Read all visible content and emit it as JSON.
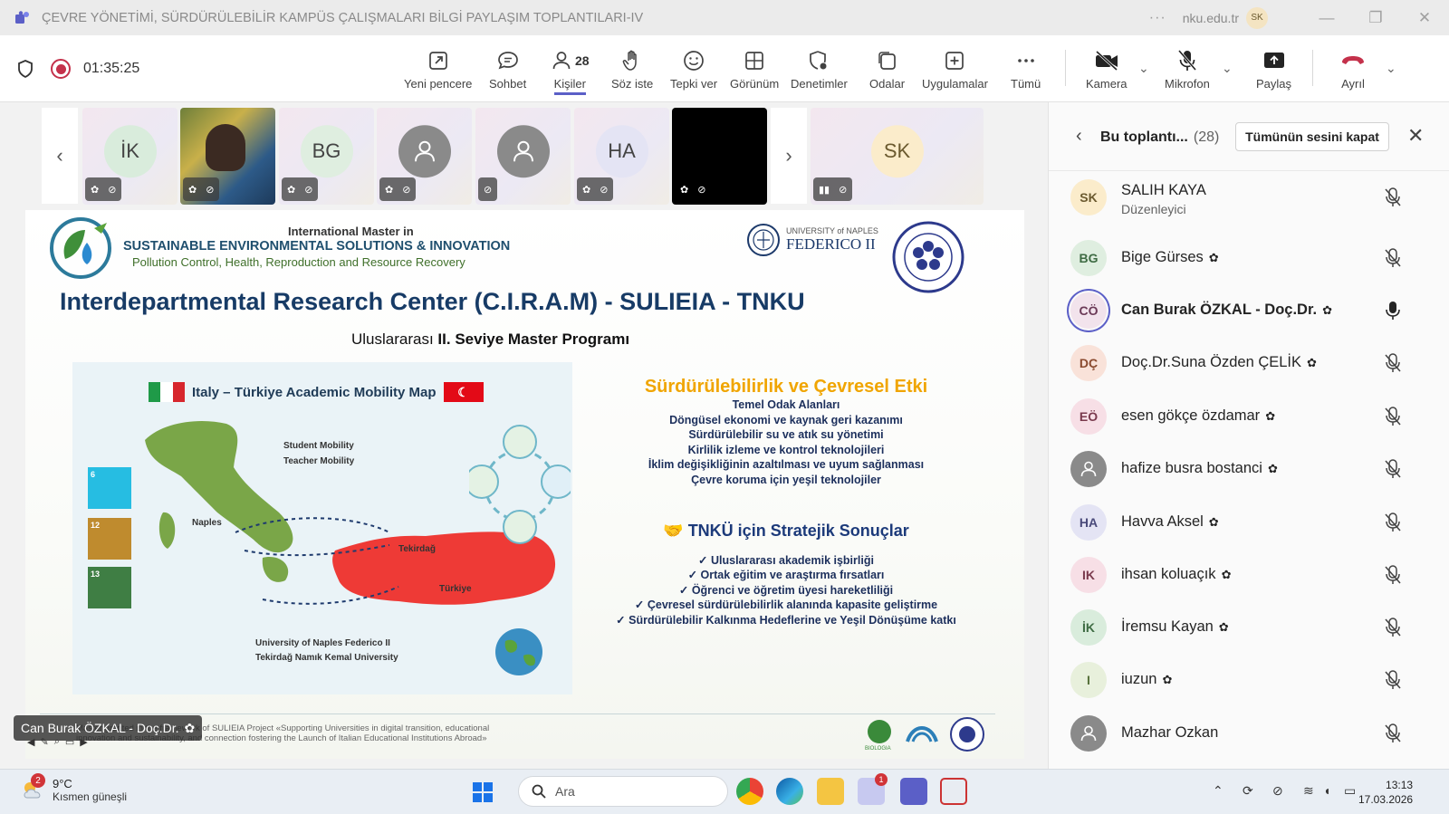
{
  "window": {
    "title": "ÇEVRE YÖNETİMİ, SÜRDÜRÜLEBİLİR KAMPÜS ÇALIŞMALARI BİLGİ PAYLAŞIM TOPLANTILARI-IV",
    "more": "···",
    "org": "nku.edu.tr",
    "avatar": "SK"
  },
  "toolbar": {
    "timer": "01:35:25",
    "people_count": "28",
    "buttons": {
      "new_window": "Yeni pencere",
      "chat": "Sohbet",
      "people": "Kişiler",
      "raise": "Söz iste",
      "react": "Tepki ver",
      "view": "Görünüm",
      "moderation": "Denetimler",
      "rooms": "Odalar",
      "apps": "Uygulamalar",
      "more": "Tümü",
      "camera": "Kamera",
      "mic": "Mikrofon",
      "share": "Paylaş",
      "leave": "Ayrıl"
    },
    "leave_color": "#c4314b",
    "accent": "#5b5fc7"
  },
  "strip": {
    "tiles": [
      {
        "initials": "İK",
        "color": "#d9ecdc"
      },
      {
        "initials": "",
        "color": "#4a5a3a"
      },
      {
        "initials": "BG",
        "color": "#dfeee0"
      },
      {
        "initials": "",
        "color": "#8a8a8a"
      },
      {
        "initials": "",
        "color": "#8a8a8a"
      },
      {
        "initials": "HA",
        "color": "#e4e4f4"
      },
      {
        "initials": "",
        "color": "#000000"
      },
      {
        "initials": "SK",
        "color": "#fbeccb"
      }
    ]
  },
  "slide": {
    "head1": "International Master in",
    "head2": "SUSTAINABLE ENVIRONMENTAL SOLUTIONS & INNOVATION",
    "head3": "Pollution Control, Health, Reproduction and Resource Recovery",
    "unina_small": "UNIVERSITY of NAPLES",
    "unina_big": "FEDERICO II",
    "title": "Interdepartmental Research  Center (C.I.R.A.M) -  SULIEIA   -   TNKU",
    "subtitle_a": "Uluslararası ",
    "subtitle_b": "II. Seviye Master Programı",
    "map": {
      "title": "Italy – Türkiye Academic Mobility Map",
      "student": "Student Mobility",
      "teacher": "Teacher Mobility",
      "naples": "Naples",
      "tekirdag": "Tekirdağ",
      "turkiye": "Türkiye",
      "uni1": "University of Naples Federico II",
      "uni2": "Tekirdağ Namık Kemal University",
      "sdg6": "6",
      "sdg12": "12",
      "sdg13": "13"
    },
    "impact": {
      "heading": "Sürdürülebilirlik ve Çevresel Etki",
      "lines": [
        "Temel Odak Alanları",
        "Döngüsel ekonomi ve kaynak geri kazanımı",
        "Sürdürülebilir su ve atık su yönetimi",
        "Kirlilik izleme ve kontrol teknolojileri",
        "İklim değişikliğinin azaltılması ve uyum sağlanması",
        "Çevre koruma için yeşil teknolojiler"
      ]
    },
    "strategic": {
      "heading": "TNKÜ için Stratejik Sonuçlar",
      "lines": [
        "✓ Uluslararası akademik işbirliği",
        "✓ Ortak eğitim ve araştırma fırsatları",
        "✓ Öğrenci ve öğretim üyesi hareketliliği",
        "✓ Çevresel sürdürülebilirlik alanında kapasite geliştirme",
        "✓ Sürdürülebilir Kalkınma Hedeflerine ve Yeşil Dönüşüme katkı"
      ]
    },
    "footer": "Master granted in the framework of SULIEIA Project «Supporting Universities in digital transition, educational\ninnovation and sustainability, and connection fostering the Launch of Italian Educational Institutions Abroad»",
    "footer_logo": "BIOLOGIA"
  },
  "presenter_chip": "Can Burak ÖZKAL - Doç.Dr.",
  "panel": {
    "title": "Bu toplantı...",
    "count": "(28)",
    "mute_all": "Tümünün sesini kapat",
    "participants": [
      {
        "initials": "SK",
        "name": "SALIH KAYA",
        "role": "Düzenleyici",
        "bg": "#fbeccb",
        "fg": "#6b5a2f",
        "badge": false,
        "mic": "off"
      },
      {
        "initials": "BG",
        "name": "Bige Gürses",
        "role": "",
        "bg": "#dfeee0",
        "fg": "#3e6b43",
        "badge": true,
        "mic": "off"
      },
      {
        "initials": "CÖ",
        "name": "Can Burak ÖZKAL - Doç.Dr.",
        "role": "",
        "bg": "#f2e3ec",
        "fg": "#6b3a57",
        "badge": true,
        "mic": "on"
      },
      {
        "initials": "DÇ",
        "name": "Doç.Dr.Suna Özden ÇELİK",
        "role": "",
        "bg": "#f9e2d9",
        "fg": "#8a4a2f",
        "badge": true,
        "mic": "off"
      },
      {
        "initials": "EÖ",
        "name": "esen gökçe özdamar",
        "role": "",
        "bg": "#f7dfe6",
        "fg": "#7a3a4d",
        "badge": true,
        "mic": "off"
      },
      {
        "initials": "",
        "name": "hafize busra bostanci",
        "role": "",
        "bg": "#8a8a8a",
        "fg": "#ffffff",
        "badge": true,
        "mic": "off"
      },
      {
        "initials": "HA",
        "name": "Havva Aksel",
        "role": "",
        "bg": "#e4e4f4",
        "fg": "#4a4a7a",
        "badge": true,
        "mic": "off"
      },
      {
        "initials": "IK",
        "name": "ihsan koluaçık",
        "role": "",
        "bg": "#f7dfe6",
        "fg": "#7a3a4d",
        "badge": true,
        "mic": "off"
      },
      {
        "initials": "İK",
        "name": "İremsu Kayan",
        "role": "",
        "bg": "#d9ecdc",
        "fg": "#3e6b43",
        "badge": true,
        "mic": "off"
      },
      {
        "initials": "I",
        "name": "iuzun",
        "role": "",
        "bg": "#e8f0dc",
        "fg": "#56703a",
        "badge": true,
        "mic": "off"
      },
      {
        "initials": "",
        "name": "Mazhar Ozkan",
        "role": "",
        "bg": "#8a8a8a",
        "fg": "#ffffff",
        "badge": false,
        "mic": "off"
      }
    ]
  },
  "taskbar": {
    "temp": "9°C",
    "weather": "Kısmen güneşli",
    "weather_badge": "2",
    "search": "Ara",
    "teams_badge": "1",
    "time": "13:13",
    "date": "17.03.2026"
  }
}
